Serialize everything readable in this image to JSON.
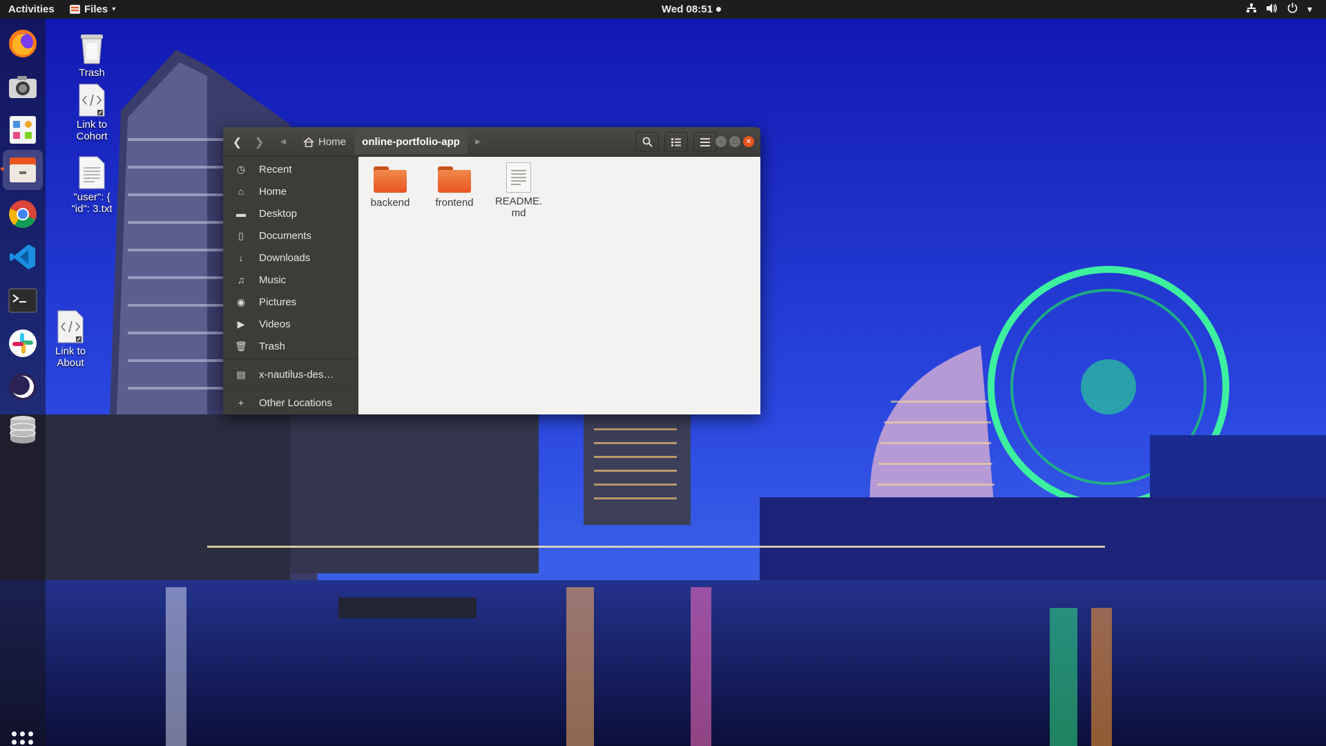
{
  "topbar": {
    "activities": "Activities",
    "app_menu": "Files",
    "clock": "Wed 08:51"
  },
  "dock": {
    "items": [
      {
        "name": "firefox-icon"
      },
      {
        "name": "camera-icon"
      },
      {
        "name": "app-store-icon"
      },
      {
        "name": "files-icon",
        "active": true
      },
      {
        "name": "chrome-icon"
      },
      {
        "name": "vscode-icon"
      },
      {
        "name": "terminal-icon"
      },
      {
        "name": "slack-icon"
      },
      {
        "name": "eclipse-icon"
      },
      {
        "name": "database-icon"
      }
    ]
  },
  "desktop": {
    "icons": [
      {
        "label": "Trash"
      },
      {
        "label": "Link to Cohort"
      },
      {
        "label": "\"user\": { \"id\": 3.txt"
      },
      {
        "label": "Link to About"
      }
    ]
  },
  "window": {
    "path_home": "Home",
    "path_current": "online-portfolio-app",
    "sidebar": [
      {
        "label": "Recent",
        "icon": "clock-icon"
      },
      {
        "label": "Home",
        "icon": "home-icon"
      },
      {
        "label": "Desktop",
        "icon": "folder-icon"
      },
      {
        "label": "Documents",
        "icon": "document-icon"
      },
      {
        "label": "Downloads",
        "icon": "download-icon"
      },
      {
        "label": "Music",
        "icon": "music-icon"
      },
      {
        "label": "Pictures",
        "icon": "camera-icon"
      },
      {
        "label": "Videos",
        "icon": "video-icon"
      },
      {
        "label": "Trash",
        "icon": "trash-icon"
      },
      {
        "label": "x-nautilus-des…",
        "icon": "drive-icon"
      },
      {
        "label": "Other Locations",
        "icon": "plus-icon"
      }
    ],
    "files": [
      {
        "label": "backend",
        "type": "folder"
      },
      {
        "label": "frontend",
        "type": "folder"
      },
      {
        "label": "README.\nmd",
        "type": "document"
      }
    ]
  },
  "colors": {
    "accent": "#e95420",
    "headerbar": "#3c3b37",
    "sidebar": "#3d3c38",
    "content": "#f3f2f1"
  }
}
